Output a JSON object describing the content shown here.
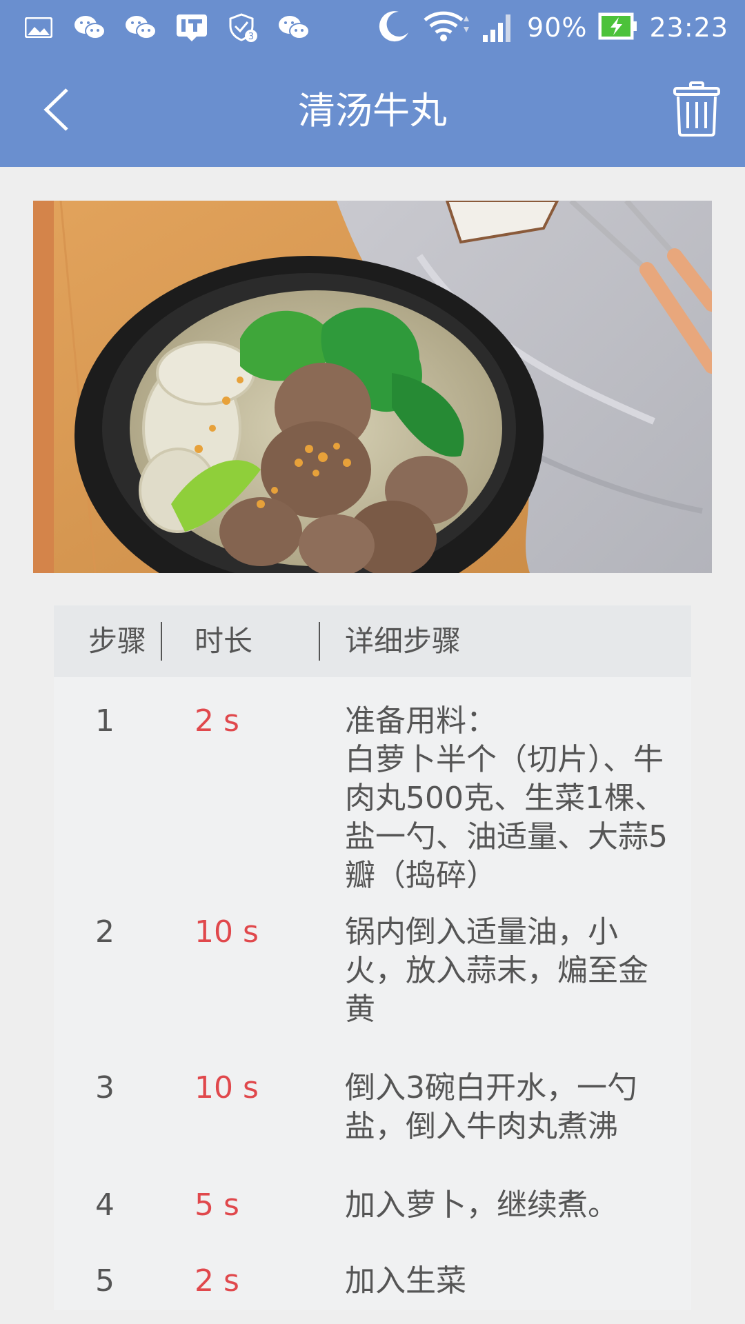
{
  "status_bar": {
    "left_icons": [
      "gallery-icon",
      "wechat-icon",
      "wechat-icon",
      "ithome-icon",
      "shield-icon",
      "wechat-icon"
    ],
    "battery_percent": "90%",
    "time": "23:23"
  },
  "app_bar": {
    "title": "清汤牛丸",
    "back_icon": "chevron-left-icon",
    "delete_icon": "trash-icon"
  },
  "hero_image": {
    "subject": "beef meatball soup in black pot"
  },
  "table": {
    "headers": {
      "step": "步骤",
      "duration": "时长",
      "detail": "详细步骤"
    },
    "rows": [
      {
        "step": "1",
        "duration": "2 s",
        "detail": "准备用料：\n白萝卜半个（切片）、牛肉丸500克、生菜1棵、盐一勺、油适量、大蒜5瓣（捣碎）"
      },
      {
        "step": "2",
        "duration": "10 s",
        "detail": "锅内倒入适量油，小火，放入蒜末，煸至金黄"
      },
      {
        "step": "3",
        "duration": "10 s",
        "detail": "倒入3碗白开水，一勺盐，倒入牛肉丸煮沸"
      },
      {
        "step": "4",
        "duration": "5 s",
        "detail": "加入萝卜，继续煮。"
      },
      {
        "step": "5",
        "duration": "2 s",
        "detail": "加入生菜"
      }
    ]
  },
  "colors": {
    "header_blue": "#6a8fcf",
    "duration_red": "#e0484c",
    "page_bg": "#eeeeee"
  }
}
